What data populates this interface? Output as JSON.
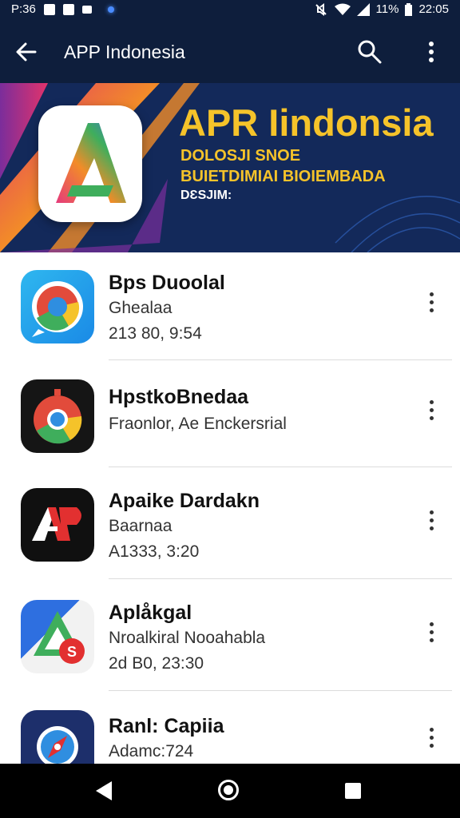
{
  "status_bar": {
    "left_text": "P:36",
    "right_text": "11%",
    "time": "22:05"
  },
  "app_bar": {
    "title": "APP Indonesia"
  },
  "banner": {
    "title": "APR Iindonsia",
    "line1": "DOLOSJI SNOE",
    "line2": "BUIETDIMIAI BIOIEMBADA",
    "line3": "DƐSJIM:"
  },
  "items": [
    {
      "name": "Bps Duoolal",
      "sub": "Ghealaa",
      "meta": "213 80, 9:54"
    },
    {
      "name": "HpstkoBnedaa",
      "sub": "Fraonlor, Ae Enckersrial",
      "meta": ""
    },
    {
      "name": "Apaike Dardakn",
      "sub": "Baarnaa",
      "meta": "A1333, 3:20"
    },
    {
      "name": "Aplåkgal",
      "sub": "Nroalkiral Nooahabla",
      "meta": "2d B0, 23:30"
    },
    {
      "name": "Ranl: Capiia",
      "sub": "Adamc:724",
      "meta": ""
    }
  ],
  "colors": {
    "app_bar": "#0e1e3c",
    "banner_accent": "#f5c32a"
  }
}
